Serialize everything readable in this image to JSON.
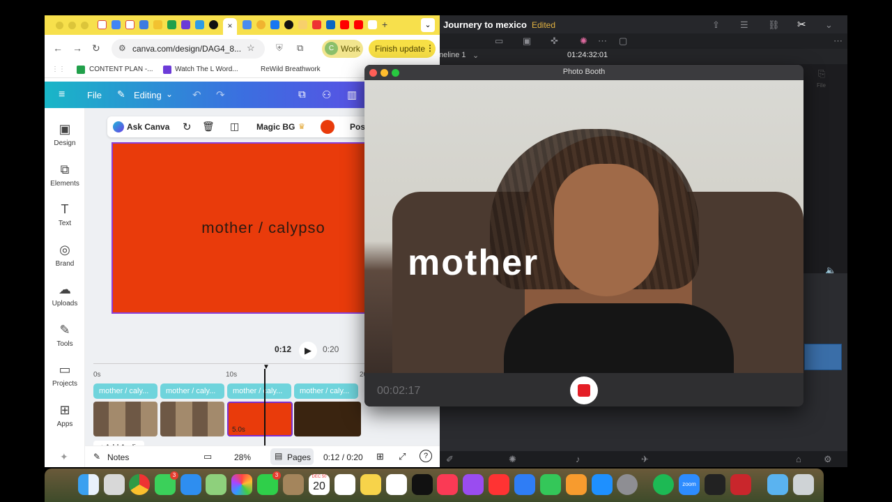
{
  "resolve": {
    "project_title": "Journery to mexico",
    "status": "Edited",
    "timeline_name": "neline 1",
    "timecode": "01:24:32:01",
    "file_label": "File"
  },
  "browser": {
    "url": "canva.com/design/DAG4_8...",
    "profile_label": "Work",
    "update_label": "Finish update",
    "bookmarks": [
      "CONTENT PLAN -...",
      "Watch The L Word...",
      "ReWild Breathwork"
    ],
    "close_tab_glyph": "×"
  },
  "canva": {
    "file_label": "File",
    "mode_label": "Editing",
    "sidebar": [
      {
        "label": "Design",
        "icon": "▣"
      },
      {
        "label": "Elements",
        "icon": "⧉"
      },
      {
        "label": "Text",
        "icon": "T"
      },
      {
        "label": "Brand",
        "icon": "◎"
      },
      {
        "label": "Uploads",
        "icon": "☁"
      },
      {
        "label": "Tools",
        "icon": "✎"
      },
      {
        "label": "Projects",
        "icon": "▭"
      },
      {
        "label": "Apps",
        "icon": "⊞"
      }
    ],
    "context_bar": {
      "ask_label": "Ask Canva",
      "magic_label": "Magic BG",
      "position_label": "Pos",
      "color": "#e93b0b"
    },
    "page_text": "mother / calypso",
    "transport": {
      "current": "0:12",
      "total": "0:20"
    },
    "ruler": [
      "0s",
      "10s",
      "20"
    ],
    "scenes": [
      "mother / caly...",
      "mother / caly...",
      "mother / caly...",
      "mother / caly..."
    ],
    "clip_duration": "5.0s",
    "add_audio_label": "Add Audio",
    "bottom": {
      "notes_label": "Notes",
      "zoom": "28%",
      "pages_label": "Pages",
      "time": "0:12 / 0:20"
    }
  },
  "photobooth": {
    "title": "Photo Booth",
    "overlay_text": "mother",
    "elapsed": "00:02:17"
  },
  "dock": {
    "calendar_month": "DEC 50",
    "calendar_day": "20",
    "messages_badge": "3",
    "facetime_badge": "3",
    "zoom_label": "zoom"
  }
}
